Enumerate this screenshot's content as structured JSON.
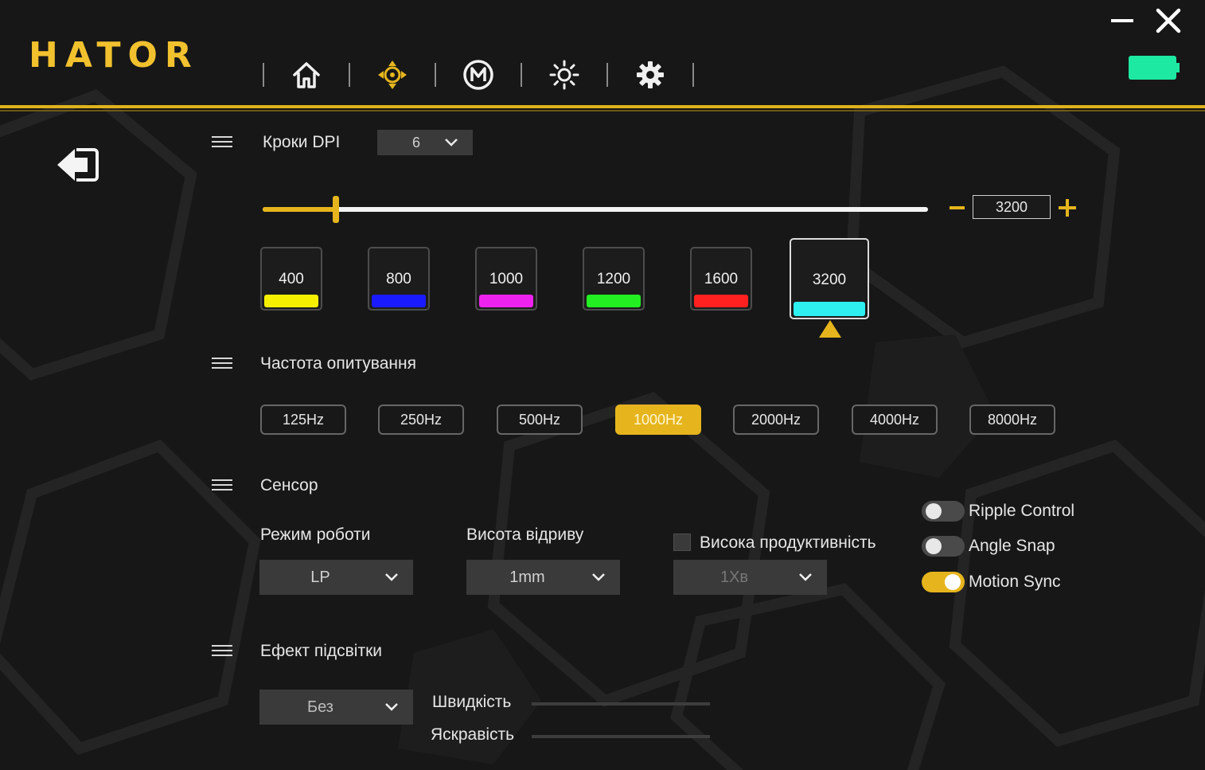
{
  "brand": "HATOR",
  "colors": {
    "accent": "#e6b51d",
    "background": "#171717",
    "battery": "#1de9a2"
  },
  "nav": [
    {
      "icon": "home-icon"
    },
    {
      "icon": "crosshair-move-icon",
      "active": true
    },
    {
      "icon": "macro-m-icon"
    },
    {
      "icon": "lighting-sun-icon"
    },
    {
      "icon": "gear-icon"
    }
  ],
  "battery": {
    "level": 1.0
  },
  "dpi": {
    "title": "Кроки DPI",
    "steps_count": "6",
    "current_value": "3200",
    "slider_fraction": 0.11,
    "steps": [
      {
        "value": "400",
        "color": "#f5f000"
      },
      {
        "value": "800",
        "color": "#1a1aff"
      },
      {
        "value": "1000",
        "color": "#ee22ee"
      },
      {
        "value": "1200",
        "color": "#22ee22"
      },
      {
        "value": "1600",
        "color": "#ff2020"
      },
      {
        "value": "3200",
        "color": "#2ef0f0",
        "active": true
      }
    ]
  },
  "polling": {
    "title": "Частота опитування",
    "rates": [
      {
        "label": "125Hz"
      },
      {
        "label": "250Hz"
      },
      {
        "label": "500Hz"
      },
      {
        "label": "1000Hz",
        "active": true
      },
      {
        "label": "2000Hz"
      },
      {
        "label": "4000Hz"
      },
      {
        "label": "8000Hz"
      }
    ]
  },
  "sensor": {
    "title": "Сенсор",
    "mode_label": "Режим роботи",
    "mode_value": "LP",
    "lod_label": "Висота відриву",
    "lod_value": "1mm",
    "hp_label": "Висока продуктивність",
    "hp_checked": false,
    "hp_value": "1Хв",
    "toggles": [
      {
        "label": "Ripple Control",
        "on": false
      },
      {
        "label": "Angle Snap",
        "on": false
      },
      {
        "label": "Motion Sync",
        "on": true
      }
    ]
  },
  "lighting": {
    "title": "Ефект підсвітки",
    "effect_value": "Без",
    "speed_label": "Швидкість",
    "brightness_label": "Яскравість"
  }
}
